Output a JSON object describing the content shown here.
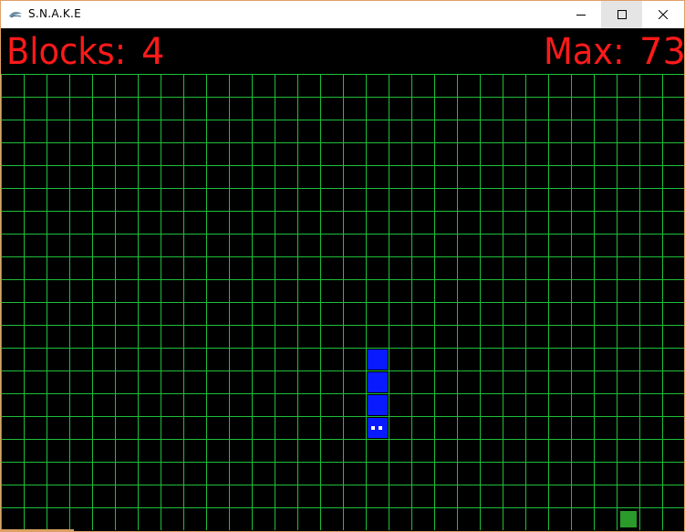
{
  "window": {
    "title": "S.N.A.K.E",
    "buttons": {
      "minimize": "minimize",
      "maximize": "maximize",
      "close": "close"
    }
  },
  "hud": {
    "blocks_label": "Blocks:",
    "blocks_value": "4",
    "max_label": "Max:",
    "max_value": "73"
  },
  "game": {
    "grid_color": "#1fbf3a",
    "snake_color": "#0a1aff",
    "snake_eye_color": "#ffffff",
    "food_color": "#2a9b2a",
    "snake": [
      {
        "col": 16,
        "row": 12
      },
      {
        "col": 16,
        "row": 13
      },
      {
        "col": 16,
        "row": 14
      },
      {
        "col": 16,
        "row": 15,
        "head": true
      }
    ],
    "food": {
      "col": 27,
      "row": 19
    }
  }
}
